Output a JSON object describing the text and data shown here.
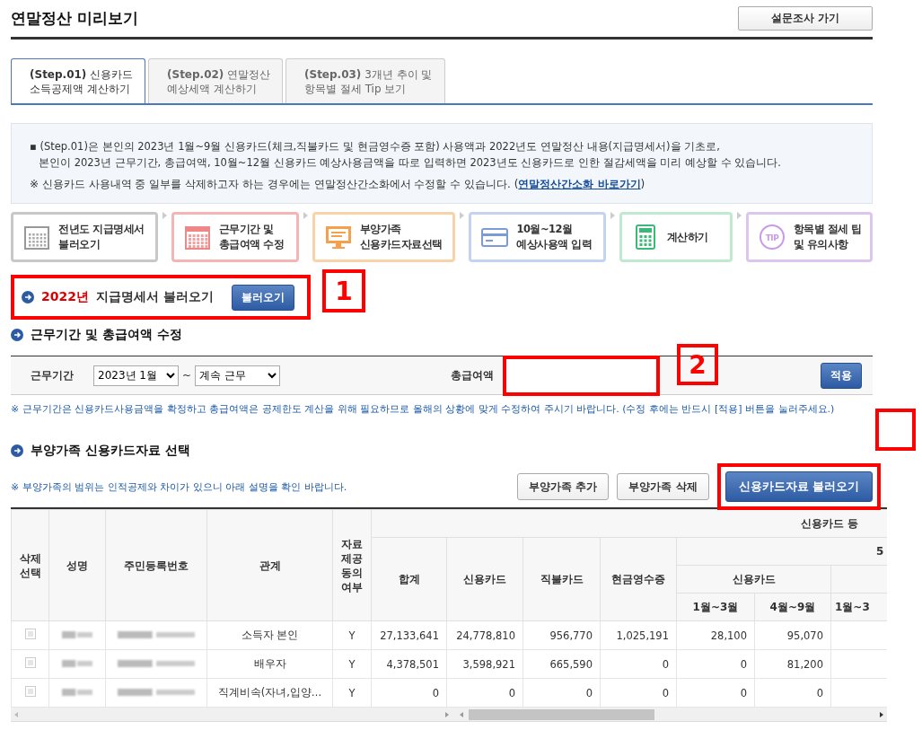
{
  "page": {
    "title": "연말정산 미리보기",
    "survey_button": "설문조사 가기"
  },
  "tabs": [
    {
      "step": "(Step.01)",
      "label_1": "신용카드",
      "label_2": "소득공제액 계산하기",
      "selected": true
    },
    {
      "step": "(Step.02)",
      "label_1": "연말정산",
      "label_2": "예상세액 계산하기",
      "selected": false
    },
    {
      "step": "(Step.03)",
      "label_1": "3개년 추이 및",
      "label_2": "항목별 절세 Tip 보기",
      "selected": false
    }
  ],
  "info": {
    "bullet": "▪",
    "lines": [
      "(Step.01)은 본인의 2023년 1월~9월 신용카드(체크,직불카드 및 현금영수증 포함) 사용액과 2022년도 연말정산 내용(지급명세서)을 기초로,",
      "본인이 2023년 근무기간, 총급여액, 10월~12월 신용카드 예상사용금액을 따로 입력하면 2023년도 신용카드로 인한 절감세액을 미리 예상할 수 있습니다."
    ],
    "note": "※ 신용카드 사용내역 중 일부를 삭제하고자 하는 경우에는 연말정산간소화에서 수정할 수 있습니다.",
    "link_open": "(",
    "link": "연말정산간소화 바로가기",
    "link_close": ")"
  },
  "steps": [
    {
      "kind": "calendar",
      "label_1": "전년도 지급명세서",
      "label_2": "불러오기",
      "color": "#c8c8c8"
    },
    {
      "kind": "grid",
      "label_1": "근무기간 및",
      "label_2": "총급여액 수정",
      "color": "#f5b5b5"
    },
    {
      "kind": "monitor",
      "label_1": "부양가족",
      "label_2": "신용카드자료선택",
      "color": "#f9d2a8"
    },
    {
      "kind": "card",
      "label_1": "10월~12월",
      "label_2": "예상사용액 입력",
      "color": "#c3d3f0"
    },
    {
      "kind": "calculator",
      "label_1": "계산하기",
      "color": "#bfe9d0"
    },
    {
      "kind": "tip",
      "icon_text": "TIP",
      "label_1": "항목별 절세 팁",
      "label_2": "및 유의사항",
      "color": "#dcc5ef"
    }
  ],
  "section_1": {
    "year": "2022년",
    "title": "지급명세서 불러오기",
    "button": "불러오기",
    "highlighted": true,
    "marker": "1"
  },
  "section_2": {
    "title": "근무기간 및 총급여액 수정",
    "period_label": "근무기간",
    "start_value": "2023년 1월",
    "separator": "~",
    "end_value": "계속 근무",
    "salary_label": "총급여액",
    "salary_highlighted": true,
    "marker": "2",
    "apply_button": "적용",
    "note": "※ 근무기간은 신용카드사용금액을 확정하고 총급여액은 공제한도 계산을 위해 필요하므로 올해의 상황에 맞게 수정하여 주시기 바랍니다. (수정 후에는 반드시 [적용] 버튼을 눌러주세요.)"
  },
  "section_3": {
    "title": "부양가족 신용카드자료 선택",
    "note": "※ 부양가족의 범위는 인적공제와 차이가 있으니 아래 설명을 확인 바랍니다.",
    "buttons": [
      {
        "label": "부양가족 추가",
        "kind": "plain",
        "highlighted": false
      },
      {
        "label": "부양가족 삭제",
        "kind": "plain",
        "highlighted": false
      },
      {
        "label": "신용카드자료 불러오기",
        "kind": "primary",
        "highlighted": true
      }
    ]
  },
  "table": {
    "fixed_columns": [
      "삭제\n선택",
      "성명",
      "주민등록번호",
      "관계",
      "자료\n제공\n동의\n여부"
    ],
    "group_header": "신용카드 등",
    "subgroup_header": "5",
    "columns": [
      "합계",
      "신용카드",
      "직불카드",
      "현금영수증"
    ],
    "card_header": "신용카드",
    "month_columns": [
      "1월~3월",
      "4월~9월",
      "1월~3"
    ],
    "rows": [
      {
        "checked": false,
        "relation": "소득자 본인",
        "agree": "Y",
        "values": [
          "27,133,641",
          "24,778,810",
          "956,770",
          "1,025,191",
          "28,100",
          "95,070"
        ]
      },
      {
        "checked": false,
        "relation": "배우자",
        "agree": "Y",
        "values": [
          "4,378,501",
          "3,598,921",
          "665,590",
          "0",
          "0",
          "81,200"
        ]
      },
      {
        "checked": false,
        "relation": "직계비속(자녀,입양…",
        "agree": "Y",
        "values": [
          "0",
          "0",
          "0",
          "0",
          "0",
          "0"
        ]
      }
    ]
  }
}
